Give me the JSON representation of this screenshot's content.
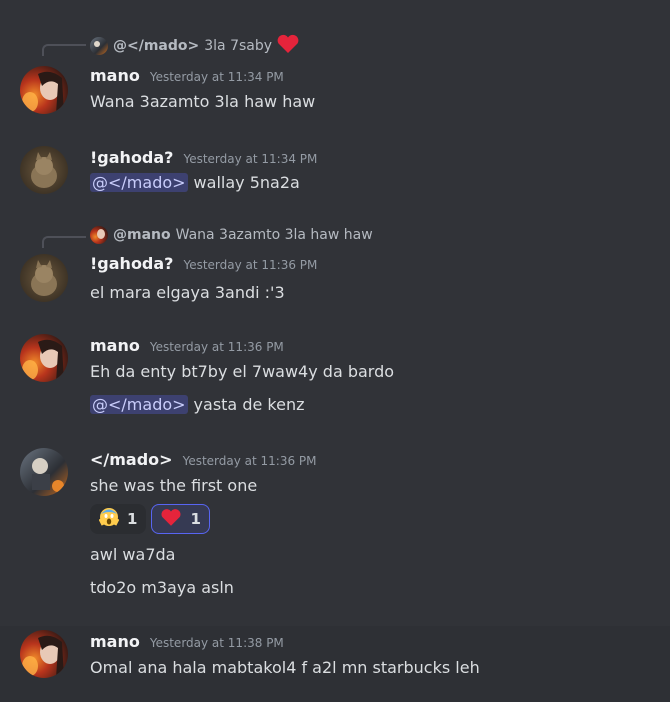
{
  "colors": {
    "background": "#313338",
    "mention_bg": "#3c4270",
    "heart": "#e5243b",
    "reaction_active_border": "#5865f2"
  },
  "messages": [
    {
      "reply": {
        "author": "@</mado>",
        "text": "3la 7saby",
        "icon": "heart-icon"
      },
      "author": "mano",
      "timestamp": "Yesterday at 11:34 PM",
      "lines": [
        {
          "text": "Wana 3azamto 3la haw haw"
        }
      ]
    },
    {
      "author": "!gahoda?",
      "timestamp": "Yesterday at 11:34 PM",
      "lines": [
        {
          "mention": "@</mado>",
          "text": "wallay 5na2a"
        }
      ]
    },
    {
      "reply": {
        "author": "@mano",
        "text": "Wana 3azamto 3la haw haw"
      },
      "author": "!gahoda?",
      "timestamp": "Yesterday at 11:36 PM",
      "lines": [
        {
          "text": "el mara elgaya 3andi :'3"
        }
      ]
    },
    {
      "author": "mano",
      "timestamp": "Yesterday at 11:36 PM",
      "lines": [
        {
          "text": "Eh da enty bt7by el 7waw4y da bardo"
        },
        {
          "mention": "@</mado>",
          "text": "yasta de kenz"
        }
      ]
    },
    {
      "author": "</mado>",
      "timestamp": "Yesterday at 11:36 PM",
      "lines": [
        {
          "text": "she was the first one"
        },
        {
          "text": "awl wa7da"
        },
        {
          "text": "tdo2o m3aya asln"
        }
      ],
      "reactions": [
        {
          "emoji": "scream-emoji-icon",
          "count": "1",
          "me": false
        },
        {
          "emoji": "heart-icon",
          "count": "1",
          "me": true
        }
      ]
    },
    {
      "author": "mano",
      "timestamp": "Yesterday at 11:38 PM",
      "lines": [
        {
          "text": "Omal ana hala mabtakol4 f a2l mn starbucks leh"
        }
      ]
    }
  ]
}
